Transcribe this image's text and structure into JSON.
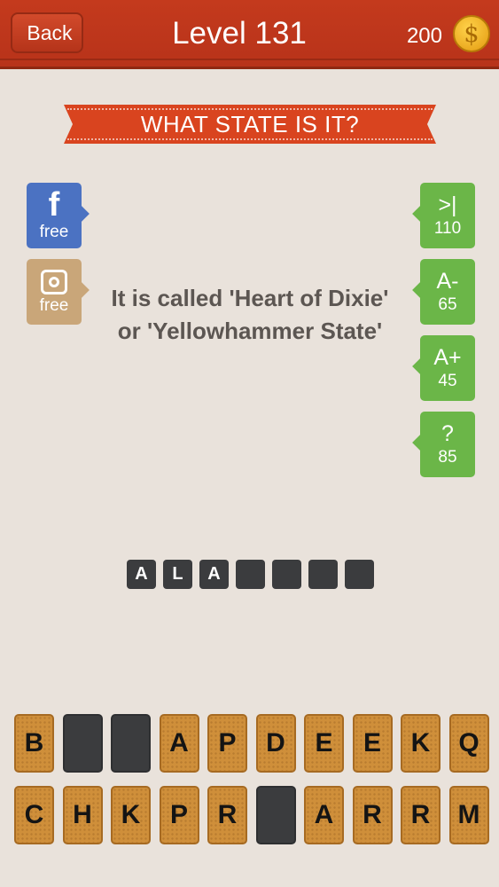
{
  "header": {
    "back_label": "Back",
    "level_title": "Level 131",
    "coins": "200",
    "coin_symbol": "$"
  },
  "banner": {
    "title": "WHAT STATE IS IT?"
  },
  "left_buttons": [
    {
      "label": "free",
      "icon": "facebook-icon",
      "color": "#4b72c2"
    },
    {
      "label": "free",
      "icon": "instagram-icon",
      "color": "#c9a679"
    }
  ],
  "right_buttons": [
    {
      "symbol": ">|",
      "cost": "110"
    },
    {
      "symbol": "A-",
      "cost": "65"
    },
    {
      "symbol": "A+",
      "cost": "45"
    },
    {
      "symbol": "?",
      "cost": "85"
    }
  ],
  "clue": "It is called 'Heart of Dixie' or 'Yellowhammer State'",
  "answer": [
    "A",
    "L",
    "A",
    "",
    "",
    "",
    ""
  ],
  "keyboard": {
    "row1": [
      "B",
      "",
      "",
      "A",
      "P",
      "D",
      "E",
      "E",
      "K",
      "Q"
    ],
    "row2": [
      "C",
      "H",
      "K",
      "P",
      "R",
      "",
      "A",
      "R",
      "R",
      "M"
    ]
  },
  "colors": {
    "header": "#c43a1d",
    "hint_green": "#6bb648",
    "tile": "#cf8f3a"
  }
}
